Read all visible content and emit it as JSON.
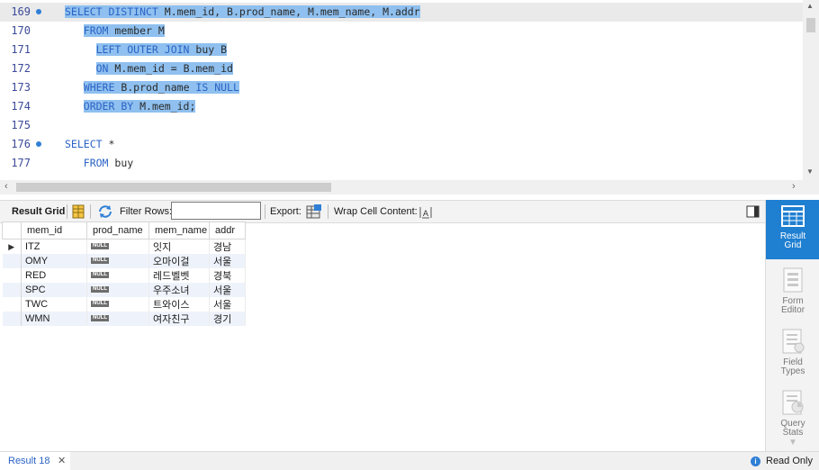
{
  "editor": {
    "lines": [
      {
        "num": "169",
        "bullet": true,
        "segments": [
          {
            "t": "SELECT DISTINCT ",
            "k": true,
            "s": true
          },
          {
            "t": "M.mem_id, B.prod_name, M.mem_name, M.addr",
            "k": false,
            "s": true
          }
        ]
      },
      {
        "num": "170",
        "bullet": false,
        "segments": [
          {
            "t": "   ",
            "k": false,
            "s": false
          },
          {
            "t": "FROM ",
            "k": true,
            "s": true
          },
          {
            "t": "member M",
            "k": false,
            "s": true
          }
        ]
      },
      {
        "num": "171",
        "bullet": false,
        "segments": [
          {
            "t": "     ",
            "k": false,
            "s": false
          },
          {
            "t": "LEFT OUTER JOIN ",
            "k": true,
            "s": true
          },
          {
            "t": "buy B",
            "k": false,
            "s": true
          }
        ]
      },
      {
        "num": "172",
        "bullet": false,
        "segments": [
          {
            "t": "     ",
            "k": false,
            "s": false
          },
          {
            "t": "ON ",
            "k": true,
            "s": true
          },
          {
            "t": "M.mem_id = B.mem_id",
            "k": false,
            "s": true
          }
        ]
      },
      {
        "num": "173",
        "bullet": false,
        "segments": [
          {
            "t": "   ",
            "k": false,
            "s": false
          },
          {
            "t": "WHERE ",
            "k": true,
            "s": true
          },
          {
            "t": "B.prod_name ",
            "k": false,
            "s": true
          },
          {
            "t": "IS NULL",
            "k": true,
            "s": true
          }
        ]
      },
      {
        "num": "174",
        "bullet": false,
        "segments": [
          {
            "t": "   ",
            "k": false,
            "s": false
          },
          {
            "t": "ORDER BY ",
            "k": true,
            "s": true
          },
          {
            "t": "M.mem_id;",
            "k": false,
            "s": true
          }
        ]
      },
      {
        "num": "175",
        "bullet": false,
        "segments": []
      },
      {
        "num": "176",
        "bullet": true,
        "segments": [
          {
            "t": "SELECT ",
            "k": true,
            "s": false
          },
          {
            "t": "*",
            "k": false,
            "s": false
          }
        ]
      },
      {
        "num": "177",
        "bullet": false,
        "segments": [
          {
            "t": "   ",
            "k": false,
            "s": false
          },
          {
            "t": "FROM ",
            "k": true,
            "s": false
          },
          {
            "t": "buy",
            "k": false,
            "s": false
          }
        ]
      }
    ]
  },
  "toolbar": {
    "result_grid": "Result Grid",
    "filter_rows": "Filter Rows:",
    "filter_value": "",
    "export": "Export:",
    "wrap_cell": "Wrap Cell Content:"
  },
  "grid": {
    "columns": [
      "mem_id",
      "prod_name",
      "mem_name",
      "addr"
    ],
    "null_label": "NULL",
    "rows": [
      {
        "mem_id": "ITZ",
        "mem_name": "잇지",
        "addr": "경남"
      },
      {
        "mem_id": "OMY",
        "mem_name": "오마이걸",
        "addr": "서울"
      },
      {
        "mem_id": "RED",
        "mem_name": "레드벨벳",
        "addr": "경북"
      },
      {
        "mem_id": "SPC",
        "mem_name": "우주소녀",
        "addr": "서울"
      },
      {
        "mem_id": "TWC",
        "mem_name": "트와이스",
        "addr": "서울"
      },
      {
        "mem_id": "WMN",
        "mem_name": "여자친구",
        "addr": "경기"
      }
    ]
  },
  "side": {
    "result_grid_1": "Result",
    "result_grid_2": "Grid",
    "form_editor_1": "Form",
    "form_editor_2": "Editor",
    "field_types_1": "Field",
    "field_types_2": "Types",
    "query_stats_1": "Query",
    "query_stats_2": "Stats"
  },
  "status": {
    "tab": "Result 18",
    "read_only": "Read Only"
  },
  "colors": {
    "accent": "#1f7fd1",
    "keyword": "#2a63c5",
    "selection": "#8fc0ef"
  }
}
